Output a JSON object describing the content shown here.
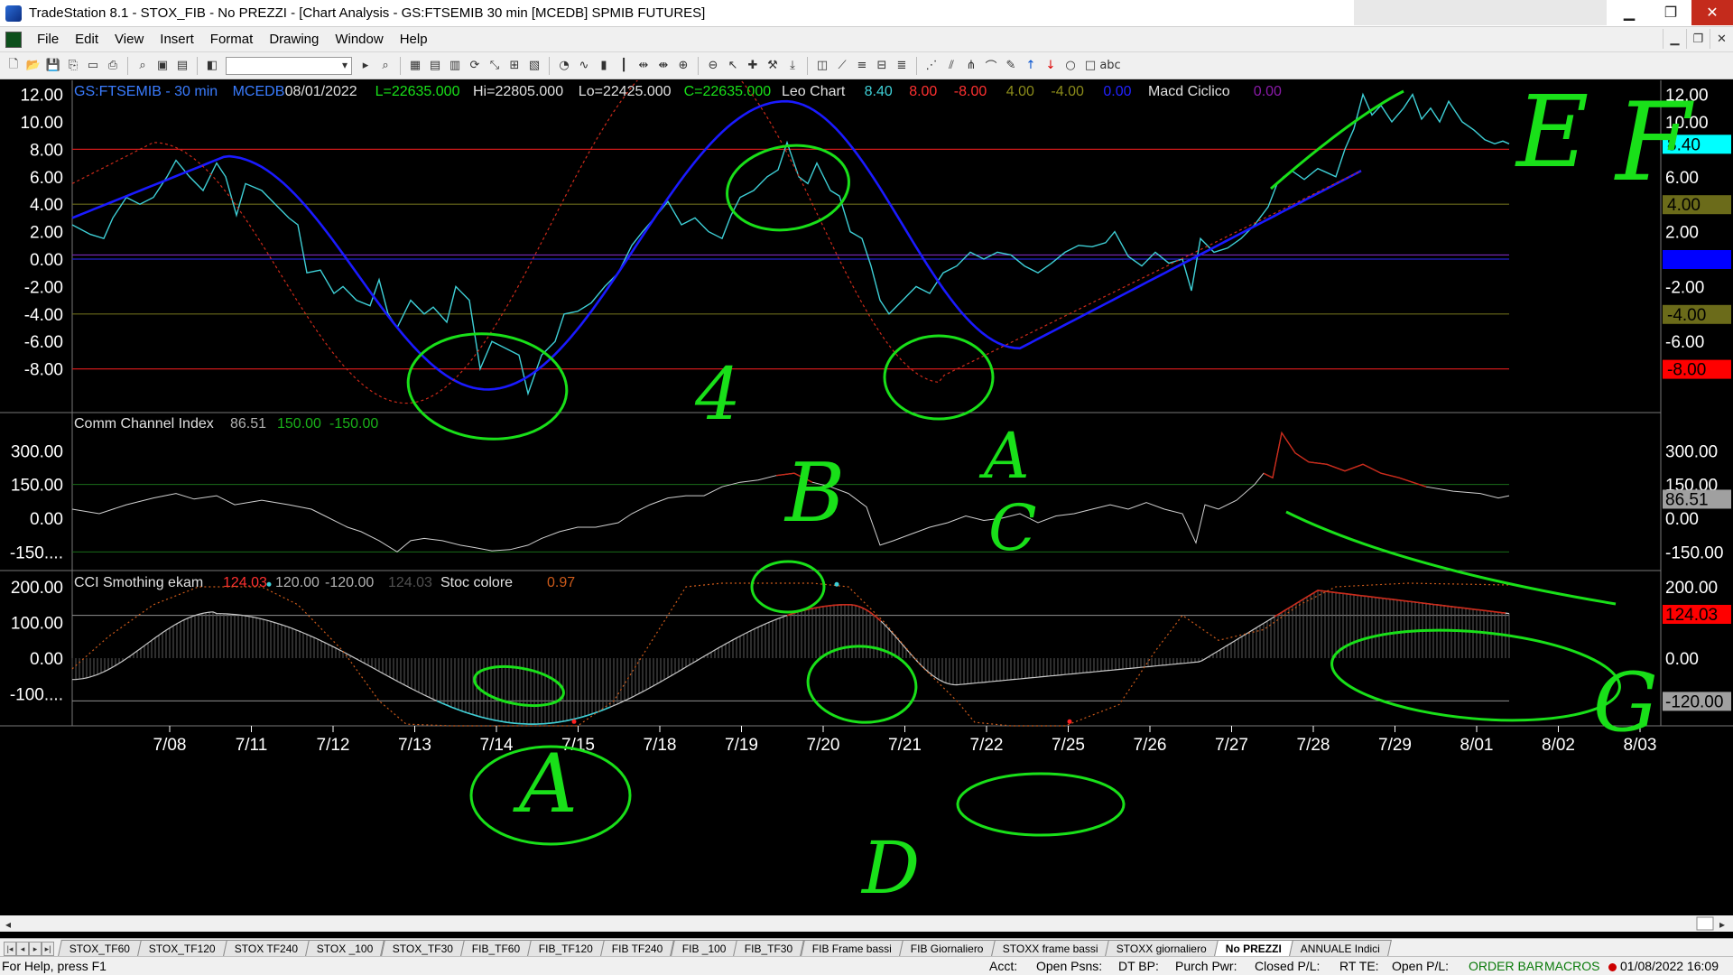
{
  "window": {
    "title": "TradeStation 8.1 - STOX_FIB - No PREZZI - [Chart Analysis - GS:FTSEMIB  30 min  [MCEDB] SPMIB FUTURES]",
    "controls": [
      "▁",
      "❐",
      "✕"
    ]
  },
  "menu": {
    "items": [
      "File",
      "Edit",
      "View",
      "Insert",
      "Format",
      "Drawing",
      "Window",
      "Help"
    ],
    "mdi": [
      "▁",
      "❐",
      "✕"
    ]
  },
  "toolbar": {
    "icons": [
      "new-doc-icon",
      "open-icon",
      "save-icon",
      "copy-icon",
      "folder-icon",
      "print-icon",
      "print-preview-icon",
      "desktop-icon",
      "save-all-icon",
      "chart-icon",
      "combo",
      "arrow-icon",
      "search-icon",
      "window-icon",
      "window2-icon",
      "grid-icon",
      "chart-link-icon",
      "zoom-icon",
      "data-icon",
      "window3-icon",
      "pie-icon",
      "wave-icon",
      "bar-icon",
      "candle-icon",
      "expand-icon",
      "shrink-icon",
      "zoom-in-icon",
      "zoom-out-icon",
      "cursor-icon",
      "cross-icon",
      "tool-icon",
      "insert-icon",
      "format-icon",
      "trend-icon",
      "lines-icon",
      "ruler-icon",
      "fib-icon",
      "gann-icon",
      "channel-icon",
      "andrew-icon",
      "arc-icon",
      "pen-icon",
      "up-arrow-icon",
      "down-arrow-icon",
      "circle-icon",
      "rect-icon",
      "text-icon"
    ]
  },
  "header": {
    "symbol": "GS:FTSEMIB - 30 min",
    "source": "MCEDB",
    "date": "08/01/2022",
    "last": "L=22635.000",
    "hi": "Hi=22805.000",
    "lo": "Lo=22425.000",
    "close": "C=22635.000",
    "study": "Leo Chart",
    "v1": "8.40",
    "v2": "8.00",
    "v3": "-8.00",
    "v4": "4.00",
    "v5": "-4.00",
    "v6": "0.00",
    "study2": "Macd Ciclico",
    "v7": "0.00"
  },
  "pane_cci": {
    "title": "Comm Channel Index",
    "v1": "86.51",
    "v2": "150.00",
    "v3": "-150.00"
  },
  "pane_ekam": {
    "title": "CCI Smothing ekam",
    "v1": "124.03",
    "v2": "120.00",
    "v3": "-120.00",
    "v4": "124.03",
    "study2": "Stoc colore",
    "v5": "0.97"
  },
  "axis_top": [
    "12.00",
    "10.00",
    "8.00",
    "6.00",
    "4.00",
    "2.00",
    "0.00",
    "-2.00",
    "-4.00",
    "-6.00",
    "-8.00"
  ],
  "axis_top_right": [
    "12.00",
    "10.00",
    "",
    "6.00",
    "",
    "2.00",
    "",
    "-2.00",
    "",
    "-6.00",
    ""
  ],
  "axis_top_badges": [
    {
      "text": "8.40",
      "bg": "#00ffff",
      "fg": "#000000"
    },
    {
      "text": "4.00",
      "bg": "#6b6b1a",
      "fg": "#000000"
    },
    {
      "text": "0.00",
      "bg": "#0000ff",
      "fg": "#0000ff"
    },
    {
      "text": "-4.00",
      "bg": "#6b6b1a",
      "fg": "#000000"
    },
    {
      "text": "-8.00",
      "bg": "#ff0000",
      "fg": "#000000"
    }
  ],
  "axis_mid": [
    "300.00",
    "150.00",
    "0.00",
    "-150...."
  ],
  "axis_mid_right": [
    "300.00",
    "150.00",
    "86.51",
    "0.00",
    "-150.00"
  ],
  "axis_bot": [
    "200.00",
    "100.00",
    "0.00",
    "-100...."
  ],
  "axis_bot_right": [
    "200.00",
    "124.03",
    "0.00",
    "-120.00"
  ],
  "dates": [
    "7/08",
    "7/11",
    "7/12",
    "7/13",
    "7/14",
    "7/15",
    "7/18",
    "7/19",
    "7/20",
    "7/21",
    "7/22",
    "7/25",
    "7/26",
    "7/27",
    "7/28",
    "7/29",
    "8/01",
    "8/02",
    "8/03"
  ],
  "handwritten": [
    "4",
    "B",
    "A",
    "C",
    "A",
    "D",
    "E",
    "F",
    "G"
  ],
  "tabs": [
    "STOX_TF60",
    "STOX_TF120",
    "STOX TF240",
    "STOX _100",
    "STOX_TF30",
    "FIB_TF60",
    "FIB_TF120",
    "FIB TF240",
    "FIB _100",
    "FIB_TF30",
    "FIB Frame bassi",
    "FIB Giornaliero",
    "STOXX frame bassi",
    "STOXX giornaliero",
    "No PREZZI",
    "ANNUALE Indici"
  ],
  "active_tab": "No PREZZI",
  "status": {
    "help": "For Help, press F1",
    "acct": "Acct:",
    "open_psns": "Open Psns:",
    "dt_bp": "DT BP:",
    "purch": "Purch Pwr:",
    "closed": "Closed P/L:",
    "rt_te": "RT TE:",
    "open_pl": "Open P/L:",
    "order_bar": "ORDER BAR",
    "macros": "MACROS",
    "datetime": "01/08/2022 16:09"
  },
  "colors": {
    "price": "#3ecfd6",
    "cycle": "#1a1aff",
    "signal": "#cc2a1a",
    "annotation": "#19e019",
    "cci": "#d0d0d0"
  }
}
